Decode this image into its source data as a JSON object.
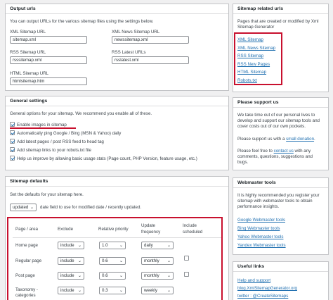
{
  "output_urls": {
    "title": "Output urls",
    "description": "You can output URLs for the various sitemap files using the settings below.",
    "xml_sitemap": {
      "label": "XML Sitemap URL",
      "value": "sitemap.xml"
    },
    "xml_news_sitemap": {
      "label": "XML News Sitemap URL",
      "value": "newssitemap.xml"
    },
    "rss_sitemap": {
      "label": "RSS Sitemap URL",
      "value": "rsssitemap.xml"
    },
    "rss_latest": {
      "label": "RSS Latest URLs",
      "value": "rsslatest.xml"
    },
    "html_sitemap": {
      "label": "HTML Sitemap URL",
      "value": "htmlsitemap.htm"
    }
  },
  "general_settings": {
    "title": "General settings",
    "description": "General options for your sitemap. We recommend you enable all of these.",
    "options": [
      {
        "label": "Enable images in sitemap",
        "checked": true
      },
      {
        "label": "Automatically ping Google / Bing (MSN & Yahoo) daily",
        "checked": true
      },
      {
        "label": "Add latest pages / post RSS feed to head tag",
        "checked": true
      },
      {
        "label": "Add sitemap links to your robots.txt file",
        "checked": true
      },
      {
        "label": "Help us improve by allowing basic usage stats (Page count, PHP Version, feature usage, etc.)",
        "checked": true
      }
    ]
  },
  "sitemap_defaults": {
    "title": "Sitemap defaults",
    "description": "Set the defaults for your sitemap here.",
    "date_select": "updated",
    "date_text": "date field to use for modified date / recently updated.",
    "headers": {
      "page_area": "Page / area",
      "exclude": "Exclude",
      "priority": "Relative priority",
      "update_line1": "Update",
      "update_line2": "frequency",
      "include_line1": "Include",
      "include_line2": "scheduled"
    },
    "rows": [
      {
        "name": "Home page",
        "exclude": "include",
        "priority": "1.0",
        "frequency": "daily",
        "scheduled": false
      },
      {
        "name": "Regular page",
        "exclude": "include",
        "priority": "0.6",
        "frequency": "monthly",
        "scheduled": false
      },
      {
        "name": "Post page",
        "exclude": "include",
        "priority": "0.6",
        "frequency": "monthly",
        "scheduled": false
      },
      {
        "name": "Taxonomy - categories",
        "exclude": "include",
        "priority": "0.3",
        "frequency": "weekly",
        "scheduled": false
      }
    ]
  },
  "related_urls": {
    "title": "Sitemap related urls",
    "description_line1": "Pages that are created or modified by Xml",
    "description_line2": "Sitemap Generator",
    "links": [
      "XML Sitemap",
      "XML News Sitemap",
      "RSS Sitemap",
      "RSS New Pages",
      "HTML Sitemap",
      "Robots.txt"
    ]
  },
  "support": {
    "title": "Please support us",
    "para1_lines": [
      "We take time out of our personal lives to",
      "develop and support our sitemap tools and",
      "cover costs out of our own pockets."
    ],
    "para2_prefix": "Please support us with a ",
    "para2_link": "small donation",
    "para2_suffix": ".",
    "para3_prefix": "Please feel free to ",
    "para3_link": "contact us",
    "para3_suffix": " with any",
    "para3_lines": [
      "comments, questions, suggestions and",
      "bugs."
    ]
  },
  "webmaster": {
    "title": "Webmaster tools",
    "desc_lines": [
      "It is highly recommended you register your",
      "sitemap with webmaster tools to obtain",
      "performance insights."
    ],
    "links": [
      "Google Webmaster tools",
      "Bing Webmaster tools",
      "Yahoo Webmaster tools",
      "Yandex Webmaster tools"
    ]
  },
  "useful_links": {
    "title": "Useful links",
    "links": [
      "Help and support",
      "blog.XmlSitemapGenerator.org",
      "twitter : @CreateSitemaps"
    ]
  },
  "colors": {
    "highlight": "#c8102e",
    "link": "#2271b1"
  }
}
